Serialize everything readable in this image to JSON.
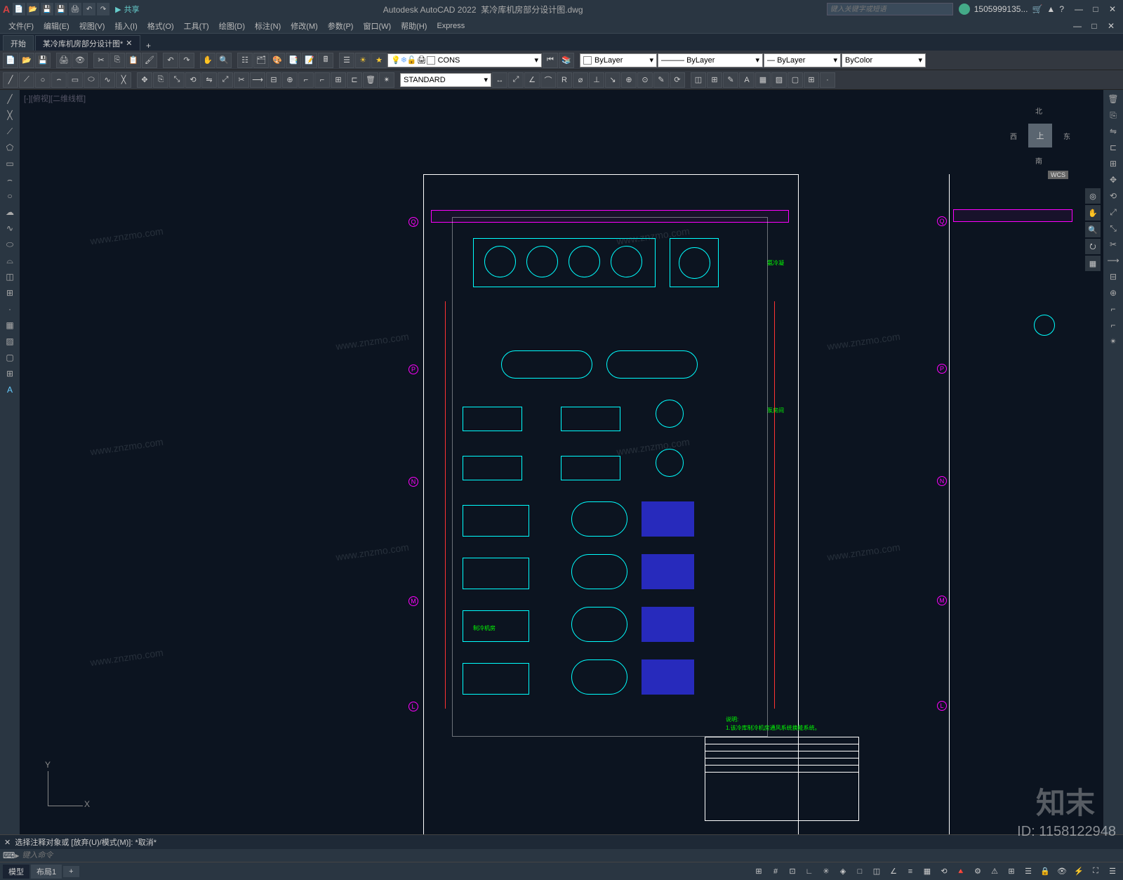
{
  "app": {
    "logo": "A",
    "title": "Autodesk AutoCAD 2022",
    "document": "某冷库机房部分设计图.dwg",
    "share": "共享",
    "search_placeholder": "键入关键字或短语",
    "username": "1505999135...",
    "win_min": "—",
    "win_max": "□",
    "win_close": "✕"
  },
  "menu": [
    "文件(F)",
    "编辑(E)",
    "视图(V)",
    "插入(I)",
    "格式(O)",
    "工具(T)",
    "绘图(D)",
    "标注(N)",
    "修改(M)",
    "参数(P)",
    "窗口(W)",
    "帮助(H)",
    "Express"
  ],
  "tabs": {
    "start": "开始",
    "doc": "某冷库机房部分设计图*",
    "add": "+"
  },
  "layer_panel": {
    "layer_name": "CONS",
    "linetype": "ByLayer",
    "lineweight": "ByLayer",
    "plotstyle": "ByLayer",
    "color": "ByColor"
  },
  "textstyle": "STANDARD",
  "viewcube": {
    "top": "上",
    "n": "北",
    "s": "南",
    "e": "东",
    "w": "西",
    "wcs": "WCS"
  },
  "ucs": {
    "x": "X",
    "y": "Y"
  },
  "grid_letters": [
    "Q",
    "P",
    "N",
    "M",
    "L"
  ],
  "drawing_labels": {
    "room1": "氨冷凝",
    "room2": "制冷机房",
    "room3": "泵房间",
    "note": "说明:",
    "note_line": "1.该冷库制冷机房通风系统换能系统。"
  },
  "cmd": {
    "history": "选择注释对象或  [放弃(U)/模式(M)]:  *取消*",
    "prompt": "▸",
    "placeholder": "键入命令"
  },
  "status": {
    "model": "模型",
    "layout1": "布局1",
    "add": "+"
  },
  "watermark": {
    "brand": "知末",
    "id": "ID: 1158122948",
    "url": "www.znzmo.com"
  },
  "icons": {
    "new": "📄",
    "open": "📂",
    "save": "💾",
    "print": "🖨",
    "undo": "↶",
    "redo": "↷",
    "line": "╱",
    "pline": "⌒",
    "circle": "○",
    "arc": "⌢",
    "rect": "▭",
    "poly": "⬠",
    "ellipse": "⬭",
    "hatch": "▦",
    "text": "A",
    "move": "✥",
    "copy": "⎘",
    "rotate": "⟲",
    "mirror": "⇋",
    "scale": "⤢",
    "trim": "✂",
    "extend": "→",
    "fillet": "⌐",
    "array": "⊞",
    "dim": "↔",
    "leader": "↘",
    "table": "⊞",
    "layer": "☰",
    "block": "◫",
    "props": "☷",
    "pan": "✋",
    "zoom": "🔍",
    "orbit": "⭮",
    "home": "⌂",
    "wheel": "◎"
  }
}
